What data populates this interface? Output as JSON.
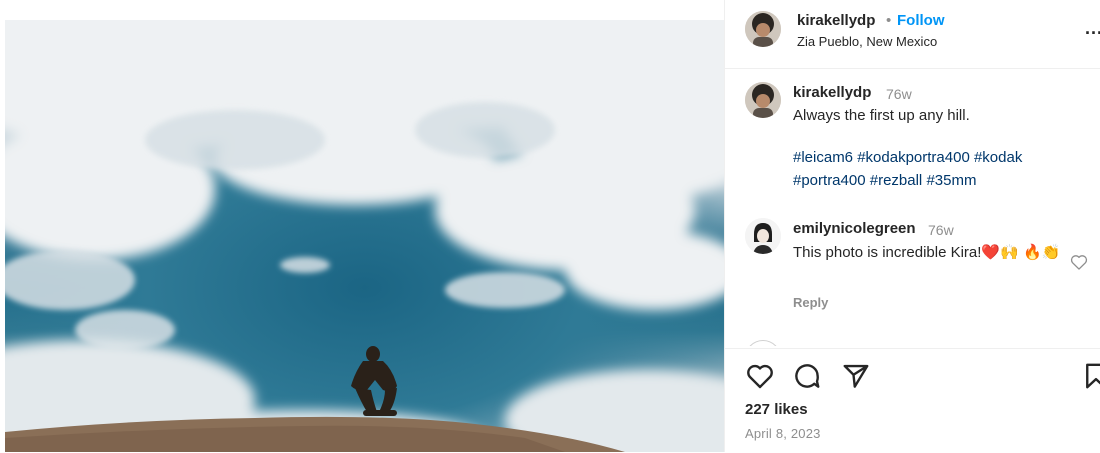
{
  "post": {
    "username": "kirakellydp",
    "follow_label": "Follow",
    "separator": "•",
    "location": "Zia Pueblo, New Mexico",
    "more_label": "...",
    "caption": {
      "username": "kirakellydp",
      "time": "76w",
      "text": "Always the first up any hill.",
      "tags": [
        "#leicam6",
        "#kodakportra400",
        "#kodak",
        "#portra400",
        "#rezball",
        "#35mm"
      ]
    },
    "comments": [
      {
        "username": "emilynicolegreen",
        "time": "76w",
        "text": "This photo is incredible Kira!❤️🙌 🔥👏",
        "reply_label": "Reply"
      }
    ],
    "likes": "227 likes",
    "date": "April 8, 2023"
  },
  "icons": {
    "like": "heart-icon",
    "comment": "comment-bubble-icon",
    "share": "paper-plane-icon",
    "save": "bookmark-icon",
    "more": "more-options-icon",
    "comment_like": "heart-outline-icon"
  },
  "colors": {
    "follow": "#0095f6",
    "hashtag": "#00376b",
    "muted": "#8e8e8e",
    "text": "#262626"
  }
}
